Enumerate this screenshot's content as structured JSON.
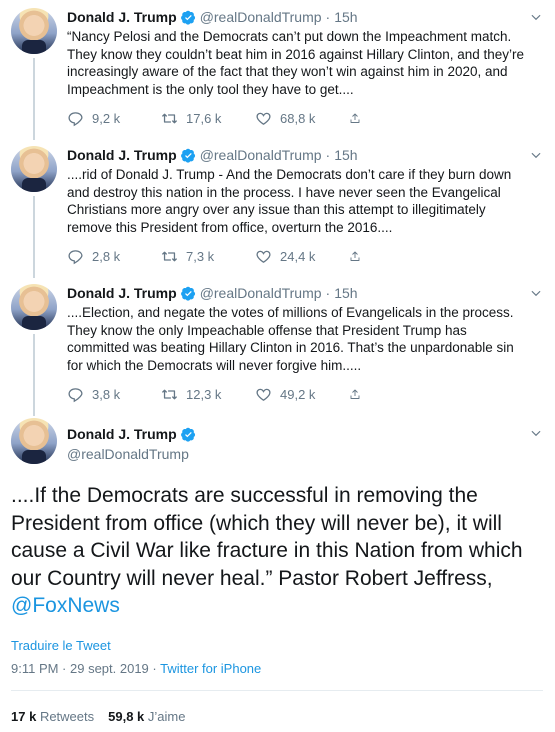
{
  "colors": {
    "link": "#1b95e0",
    "verified": "#1da1f2",
    "muted": "#657786",
    "text": "#14171a"
  },
  "thread": [
    {
      "name": "Donald J. Trump",
      "handle": "@realDonaldTrump",
      "time": "15h",
      "lines": [
        "“Nancy Pelosi and the Democrats can’t put down the Impeachment match.",
        "They know they couldn’t beat him in 2016 against Hillary Clinton, and they’re",
        "increasingly aware of the fact that they won’t win against him in 2020, and",
        "Impeachment is the only tool they have to get...."
      ],
      "replies": "9,2 k",
      "retweets": "17,6 k",
      "likes": "68,8 k"
    },
    {
      "name": "Donald J. Trump",
      "handle": "@realDonaldTrump",
      "time": "15h",
      "lines": [
        "....rid of Donald J. Trump - And the Democrats don’t care if they burn down",
        "and destroy this nation in the process. I have never seen the Evangelical",
        "Christians more angry over any issue than this attempt to illegitimately",
        "remove this President from office, overturn the 2016...."
      ],
      "replies": "2,8 k",
      "retweets": "7,3 k",
      "likes": "24,4 k"
    },
    {
      "name": "Donald J. Trump",
      "handle": "@realDonaldTrump",
      "time": "15h",
      "lines": [
        "....Election, and negate the votes of millions of Evangelicals in the process.",
        "They know the only Impeachable offense that President Trump has",
        "committed was beating Hillary Clinton in 2016. That’s the unpardonable sin",
        "for which the Democrats will never forgive him....."
      ],
      "replies": "3,8 k",
      "retweets": "12,3 k",
      "likes": "49,2 k"
    }
  ],
  "main": {
    "name": "Donald J. Trump",
    "handle": "@realDonaldTrump",
    "lines": [
      "....If the Democrats are successful in removing the",
      "President from office (which they will never be), it will",
      "cause a Civil War like fracture in this Nation from which",
      "our Country will never heal.” Pastor Robert Jeffress,"
    ],
    "mention": "@FoxNews",
    "translate": "Traduire le Tweet",
    "timestamp": "9:11 PM · 29 sept. 2019 · ",
    "source": "Twitter for iPhone",
    "retweet_count": "17 k",
    "retweet_label": "Retweets",
    "like_count": "59,8 k",
    "like_label": "J’aime"
  },
  "icons": [
    "reply-icon",
    "retweet-icon",
    "like-icon",
    "share-icon",
    "verified-badge-icon",
    "chevron-down-icon"
  ]
}
